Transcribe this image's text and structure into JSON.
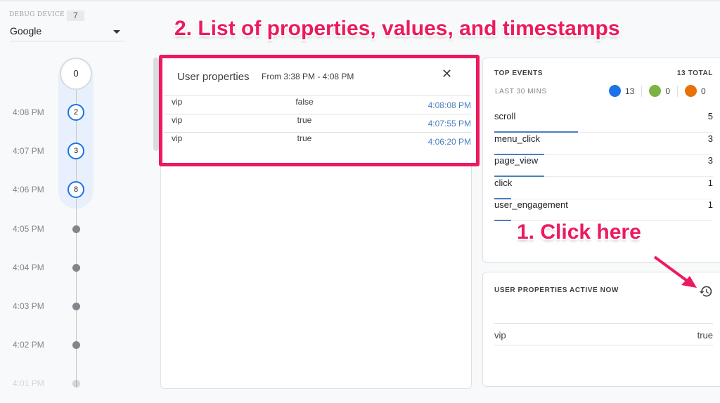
{
  "annotations": {
    "list": "2. List of properties, values, and timestamps",
    "click": "1. Click here",
    "color": "#ec1a5e"
  },
  "sidebar": {
    "debug_device_label": "DEBUG DEVICE",
    "device_count": "7",
    "device": "Google",
    "timeline": {
      "top_count": "0",
      "bubbles": [
        {
          "time": "4:08 PM",
          "count": "2"
        },
        {
          "time": "4:07 PM",
          "count": "3"
        },
        {
          "time": "4:06 PM",
          "count": "8"
        }
      ],
      "empty": [
        "4:05 PM",
        "4:04 PM",
        "4:03 PM",
        "4:02 PM",
        "4:01 PM"
      ]
    }
  },
  "user_properties": {
    "title": "User properties",
    "range": "From 3:38 PM - 4:08 PM",
    "rows": [
      {
        "key": "vip",
        "value": "false",
        "time": "4:08:08 PM"
      },
      {
        "key": "vip",
        "value": "true",
        "time": "4:07:55 PM"
      },
      {
        "key": "vip",
        "value": "true",
        "time": "4:06:20 PM"
      }
    ]
  },
  "top_events": {
    "title": "TOP EVENTS",
    "total": "13 TOTAL",
    "period": "LAST 30 MINS",
    "counters": [
      {
        "icon": "user-icon",
        "value": "13",
        "color": "#1a73e8"
      },
      {
        "icon": "flag-icon",
        "value": "0",
        "color": "#7cb342"
      },
      {
        "icon": "gift-icon",
        "value": "0",
        "color": "#e8710a"
      }
    ],
    "events": [
      {
        "name": "scroll",
        "count": 5
      },
      {
        "name": "menu_click",
        "count": 3
      },
      {
        "name": "page_view",
        "count": 3
      },
      {
        "name": "click",
        "count": 1
      },
      {
        "name": "user_engagement",
        "count": 1
      }
    ]
  },
  "active_props": {
    "title": "USER PROPERTIES ACTIVE NOW",
    "rows": [
      {
        "key": "vip",
        "value": "true"
      }
    ]
  }
}
